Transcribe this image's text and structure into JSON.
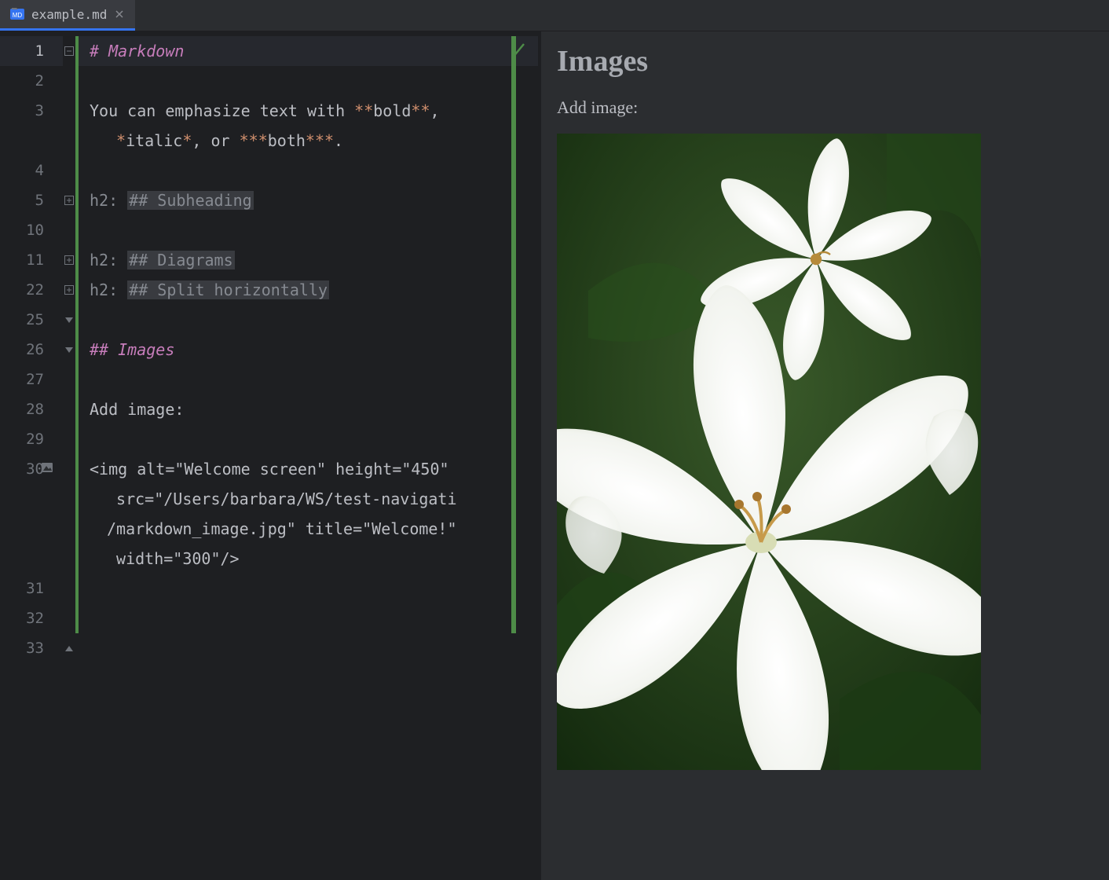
{
  "tab": {
    "filename": "example.md",
    "icon": "markdown-file-icon"
  },
  "editor": {
    "active_line": 1,
    "lines": [
      {
        "num": 1,
        "type": "h1",
        "hash": "# ",
        "text": "Markdown"
      },
      {
        "num": 2,
        "type": "blank"
      },
      {
        "num": 3,
        "type": "para",
        "segments": [
          {
            "t": "You can emphasize text with ",
            "cls": "c-text"
          },
          {
            "t": "**",
            "cls": "c-bold"
          },
          {
            "t": "bold",
            "cls": "c-text"
          },
          {
            "t": "**",
            "cls": "c-bold"
          },
          {
            "t": ",",
            "cls": "c-text"
          }
        ],
        "wrap": [
          {
            "t": " ",
            "cls": "c-text"
          },
          {
            "t": "*",
            "cls": "c-bold"
          },
          {
            "t": "italic",
            "cls": "c-text"
          },
          {
            "t": "*",
            "cls": "c-bold"
          },
          {
            "t": ", or ",
            "cls": "c-text"
          },
          {
            "t": "***",
            "cls": "c-bold"
          },
          {
            "t": "both",
            "cls": "c-text"
          },
          {
            "t": "***",
            "cls": "c-bold"
          },
          {
            "t": ".",
            "cls": "c-text"
          }
        ]
      },
      {
        "num": 4,
        "type": "blank"
      },
      {
        "num": 5,
        "type": "fold",
        "label": "h2: ",
        "content": "## Subheading"
      },
      {
        "num": 10,
        "type": "blank"
      },
      {
        "num": 11,
        "type": "fold",
        "label": "h2: ",
        "content": "## Diagrams"
      },
      {
        "num": 22,
        "type": "fold",
        "label": "h2: ",
        "content": "## Split horizontally"
      },
      {
        "num": 25,
        "type": "blank"
      },
      {
        "num": 26,
        "type": "h2",
        "hash": "## ",
        "text": "Images"
      },
      {
        "num": 27,
        "type": "blank"
      },
      {
        "num": 28,
        "type": "plain",
        "text": "Add image:"
      },
      {
        "num": 29,
        "type": "blank"
      },
      {
        "num": 30,
        "type": "html",
        "icon": "image-gutter-icon",
        "rows": [
          "<img alt=\"Welcome screen\" height=\"450\"",
          " src=\"/Users/barbara/WS/test-navigati",
          "/markdown_image.jpg\" title=\"Welcome!\"",
          " width=\"300\"/>"
        ]
      },
      {
        "num": 31,
        "type": "blank"
      },
      {
        "num": 32,
        "type": "blank"
      },
      {
        "num": 33,
        "type": "blank"
      }
    ],
    "inspection_status": "no-problems"
  },
  "preview": {
    "heading": "Images",
    "text": "Add image:"
  },
  "colors": {
    "heading": "#c77dbb",
    "markup": "#cf8e6d",
    "selection_bg": "#26282e",
    "active_tab_underline": "#3574f0",
    "gutter_bar": "#4e8c48"
  }
}
